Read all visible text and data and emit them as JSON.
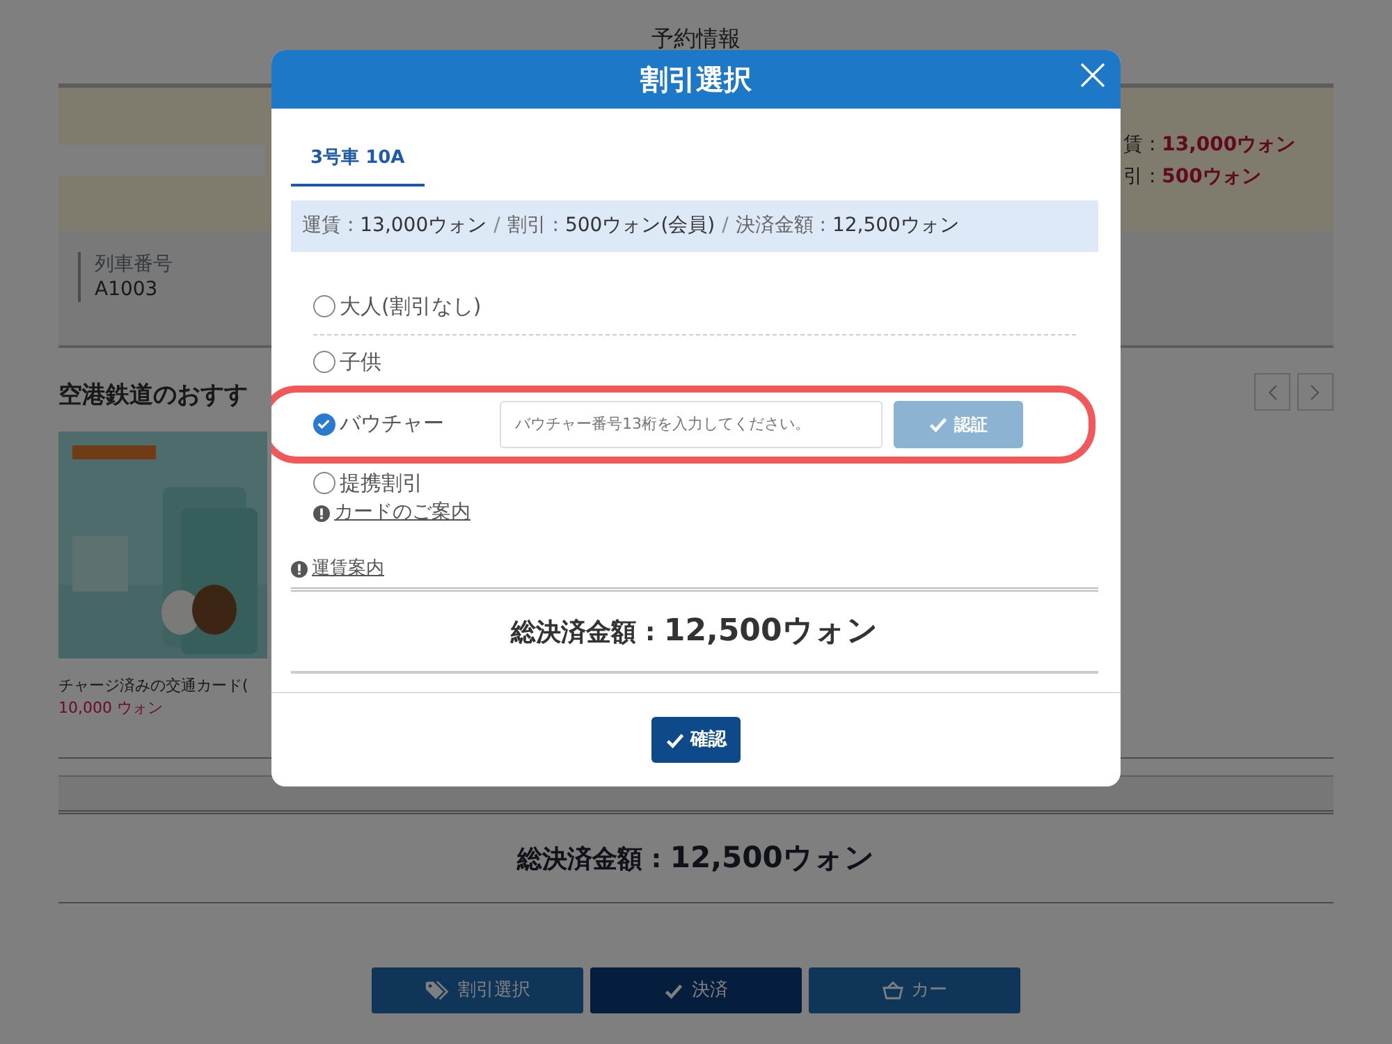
{
  "page": {
    "title": "予約情報",
    "fare_labels": [
      {
        "label": "賃 :",
        "value": "13,000ウォン"
      },
      {
        "label": "引 :",
        "value": "500ウォン"
      }
    ],
    "train_label": "列車番号",
    "train_number": "A1003",
    "recommend_title": "空港鉄道のおすす",
    "product": {
      "kind": "picture",
      "caption": "チャージ済みの交通カード(",
      "price": "10,000 ウォン"
    },
    "total_label": "総決済金額 :",
    "total_value": "12,500ウォン",
    "buttons": [
      {
        "kind": "tag",
        "label": "割引選択",
        "selected": false
      },
      {
        "kind": "check",
        "label": "決済",
        "selected": true
      },
      {
        "kind": "basket",
        "label": "カー",
        "selected": false
      }
    ]
  },
  "modal": {
    "title": "割引選択",
    "tabs": [
      {
        "label": "3号車 10A",
        "selected": true
      }
    ],
    "summary": [
      {
        "label": "運賃 :",
        "value": "13,000ウォン"
      },
      {
        "label": "割引 :",
        "value": "500ウォン(会員)"
      },
      {
        "label": "決済金額 :",
        "value": "12,500ウォン"
      }
    ],
    "summary_separator": "/",
    "options": [
      {
        "label": "大人(割引なし)",
        "checked": false,
        "highlighted": false
      },
      {
        "label": "子供",
        "checked": false,
        "highlighted": false
      },
      {
        "label": "バウチャー",
        "checked": true,
        "highlighted": true,
        "field": {
          "placeholder": "バウチャー番号13桁を入力してください。"
        },
        "button": {
          "label": "認証",
          "disabled": true
        }
      },
      {
        "label": "提携割引",
        "checked": false,
        "highlighted": false,
        "link": "カードのご案内"
      }
    ],
    "fare_link": "運賃案内",
    "total_label": "総決済金額 :",
    "total_value": "12,500ウォン",
    "confirm": "確認"
  }
}
